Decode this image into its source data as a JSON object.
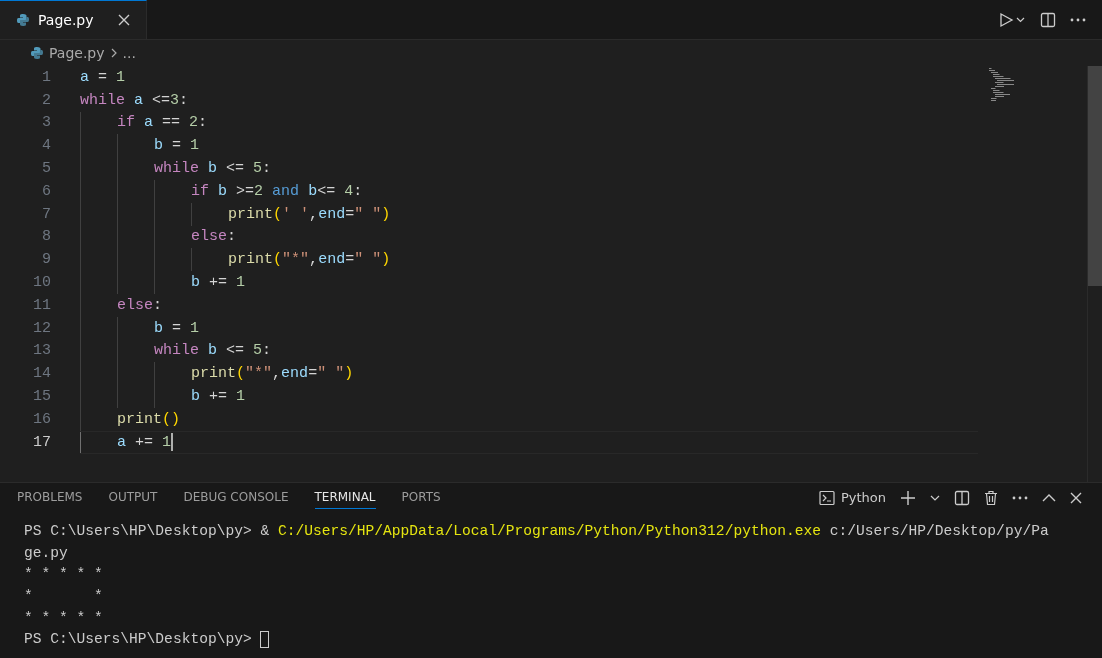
{
  "tabs": [
    {
      "label": "Page.py",
      "selected": true
    }
  ],
  "breadcrumb": {
    "file": "Page.py",
    "more": "..."
  },
  "code": [
    {
      "number": "1",
      "active": false,
      "tokens": [
        {
          "kind": "var",
          "text": "a"
        },
        {
          "kind": "plain",
          "text": " = "
        },
        {
          "kind": "num",
          "text": "1"
        }
      ]
    },
    {
      "number": "2",
      "active": false,
      "tokens": [
        {
          "kind": "kw",
          "text": "while"
        },
        {
          "kind": "var",
          "text": " a"
        },
        {
          "kind": "plain",
          "text": " <="
        },
        {
          "kind": "num",
          "text": "3"
        },
        {
          "kind": "plain",
          "text": ":"
        }
      ]
    },
    {
      "number": "3",
      "active": false,
      "tokens": [
        {
          "kind": "kw",
          "text": "    if"
        },
        {
          "kind": "var",
          "text": " a"
        },
        {
          "kind": "plain",
          "text": " == "
        },
        {
          "kind": "num",
          "text": "2"
        },
        {
          "kind": "plain",
          "text": ":"
        }
      ]
    },
    {
      "number": "4",
      "active": false,
      "tokens": [
        {
          "kind": "var",
          "text": "        b"
        },
        {
          "kind": "plain",
          "text": " = "
        },
        {
          "kind": "num",
          "text": "1"
        }
      ]
    },
    {
      "number": "5",
      "active": false,
      "tokens": [
        {
          "kind": "kw",
          "text": "        while"
        },
        {
          "kind": "var",
          "text": " b"
        },
        {
          "kind": "plain",
          "text": " <= "
        },
        {
          "kind": "num",
          "text": "5"
        },
        {
          "kind": "plain",
          "text": ":"
        }
      ]
    },
    {
      "number": "6",
      "active": false,
      "tokens": [
        {
          "kind": "kw",
          "text": "            if"
        },
        {
          "kind": "var",
          "text": " b"
        },
        {
          "kind": "plain",
          "text": " >="
        },
        {
          "kind": "num",
          "text": "2"
        },
        {
          "kind": "logic",
          "text": " and"
        },
        {
          "kind": "var",
          "text": " b"
        },
        {
          "kind": "plain",
          "text": "<= "
        },
        {
          "kind": "num",
          "text": "4"
        },
        {
          "kind": "plain",
          "text": ":"
        }
      ]
    },
    {
      "number": "7",
      "active": false,
      "tokens": [
        {
          "kind": "fn",
          "text": "                print"
        },
        {
          "kind": "paren",
          "text": "("
        },
        {
          "kind": "str",
          "text": "' '"
        },
        {
          "kind": "plain",
          "text": ","
        },
        {
          "kind": "var",
          "text": "end"
        },
        {
          "kind": "plain",
          "text": "="
        },
        {
          "kind": "str",
          "text": "\" \""
        },
        {
          "kind": "paren",
          "text": ")"
        }
      ]
    },
    {
      "number": "8",
      "active": false,
      "tokens": [
        {
          "kind": "kw",
          "text": "            else"
        },
        {
          "kind": "plain",
          "text": ":"
        }
      ]
    },
    {
      "number": "9",
      "active": false,
      "tokens": [
        {
          "kind": "fn",
          "text": "                print"
        },
        {
          "kind": "paren",
          "text": "("
        },
        {
          "kind": "str",
          "text": "\"*\""
        },
        {
          "kind": "plain",
          "text": ","
        },
        {
          "kind": "var",
          "text": "end"
        },
        {
          "kind": "plain",
          "text": "="
        },
        {
          "kind": "str",
          "text": "\" \""
        },
        {
          "kind": "paren",
          "text": ")"
        }
      ]
    },
    {
      "number": "10",
      "active": false,
      "tokens": [
        {
          "kind": "var",
          "text": "            b"
        },
        {
          "kind": "plain",
          "text": " += "
        },
        {
          "kind": "num",
          "text": "1"
        }
      ]
    },
    {
      "number": "11",
      "active": false,
      "tokens": [
        {
          "kind": "kw",
          "text": "    else"
        },
        {
          "kind": "plain",
          "text": ":"
        }
      ]
    },
    {
      "number": "12",
      "active": false,
      "tokens": [
        {
          "kind": "var",
          "text": "        b"
        },
        {
          "kind": "plain",
          "text": " = "
        },
        {
          "kind": "num",
          "text": "1"
        }
      ]
    },
    {
      "number": "13",
      "active": false,
      "tokens": [
        {
          "kind": "kw",
          "text": "        while"
        },
        {
          "kind": "var",
          "text": " b"
        },
        {
          "kind": "plain",
          "text": " <= "
        },
        {
          "kind": "num",
          "text": "5"
        },
        {
          "kind": "plain",
          "text": ":"
        }
      ]
    },
    {
      "number": "14",
      "active": false,
      "tokens": [
        {
          "kind": "fn",
          "text": "            print"
        },
        {
          "kind": "paren",
          "text": "("
        },
        {
          "kind": "str",
          "text": "\"*\""
        },
        {
          "kind": "plain",
          "text": ","
        },
        {
          "kind": "var",
          "text": "end"
        },
        {
          "kind": "plain",
          "text": "="
        },
        {
          "kind": "str",
          "text": "\" \""
        },
        {
          "kind": "paren",
          "text": ")"
        }
      ]
    },
    {
      "number": "15",
      "active": false,
      "tokens": [
        {
          "kind": "var",
          "text": "            b"
        },
        {
          "kind": "plain",
          "text": " += "
        },
        {
          "kind": "num",
          "text": "1"
        }
      ]
    },
    {
      "number": "16",
      "active": false,
      "tokens": [
        {
          "kind": "fn",
          "text": "    print"
        },
        {
          "kind": "paren",
          "text": "()"
        }
      ]
    },
    {
      "number": "17",
      "active": true,
      "tokens": [
        {
          "kind": "var",
          "text": "    a"
        },
        {
          "kind": "plain",
          "text": " += "
        },
        {
          "kind": "num",
          "text": "1"
        }
      ]
    }
  ],
  "panel_tabs": [
    {
      "label": "PROBLEMS",
      "selected": false
    },
    {
      "label": "OUTPUT",
      "selected": false
    },
    {
      "label": "DEBUG CONSOLE",
      "selected": false
    },
    {
      "label": "TERMINAL",
      "selected": true
    },
    {
      "label": "PORTS",
      "selected": false
    }
  ],
  "terminal_name": "Python",
  "terminal": [
    {
      "cursor": false,
      "segments": [
        {
          "kind": "plain",
          "text": "PS C:\\Users\\HP\\Desktop\\py> & "
        },
        {
          "kind": "path",
          "text": "C:/Users/HP/AppData/Local/Programs/Python/Python312/python.exe"
        },
        {
          "kind": "plain",
          "text": " c:/Users/HP/Desktop/py/Pa"
        }
      ]
    },
    {
      "cursor": false,
      "segments": [
        {
          "kind": "plain",
          "text": "ge.py"
        }
      ]
    },
    {
      "cursor": false,
      "segments": [
        {
          "kind": "plain",
          "text": "* * * * *"
        }
      ]
    },
    {
      "cursor": false,
      "segments": [
        {
          "kind": "plain",
          "text": "*       *"
        }
      ]
    },
    {
      "cursor": false,
      "segments": [
        {
          "kind": "plain",
          "text": "* * * * *"
        }
      ]
    },
    {
      "cursor": true,
      "segments": [
        {
          "kind": "plain",
          "text": "PS C:\\Users\\HP\\Desktop\\py> "
        }
      ]
    }
  ]
}
